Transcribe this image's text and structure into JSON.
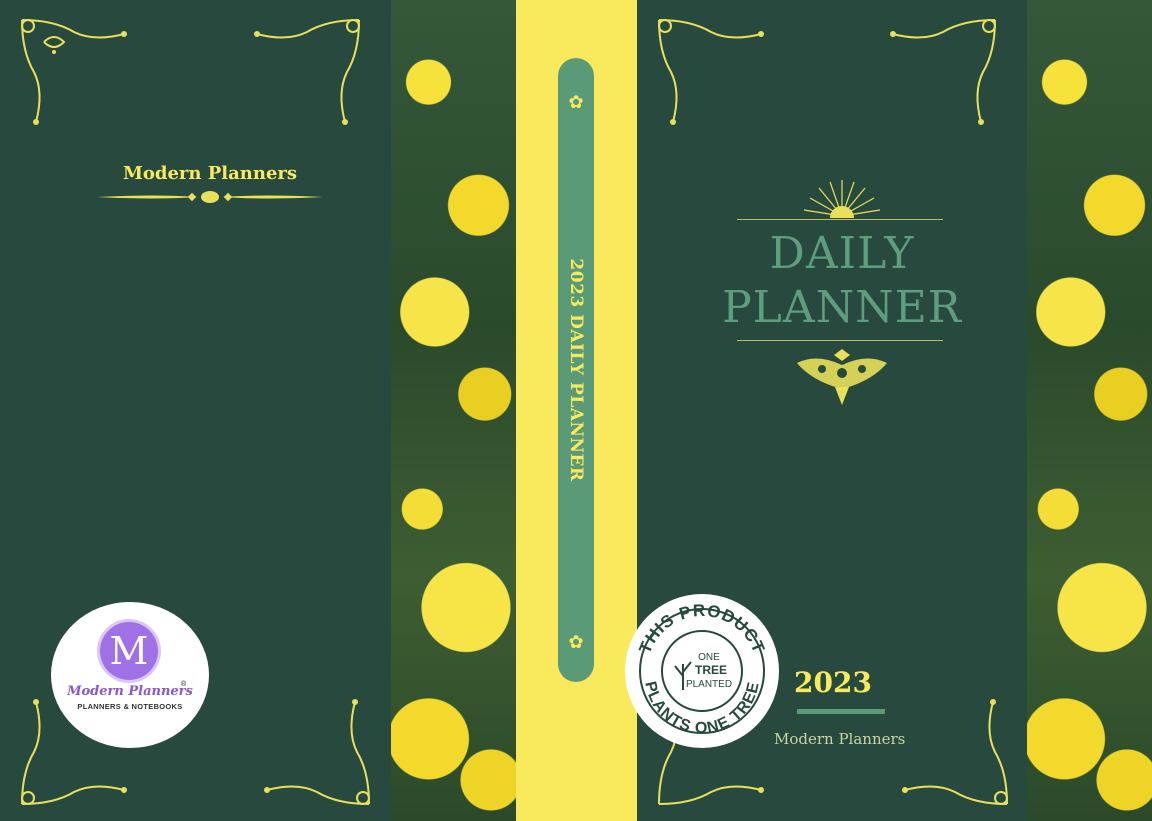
{
  "back_cover": {
    "brand_title": "Modern Planners",
    "logo": {
      "letter": "M",
      "script_name": "Modern Planners",
      "registered_mark": "®",
      "tagline": "PLANNERS & NOTEBOOKS"
    }
  },
  "spine": {
    "title": "2023 DAILY PLANNER"
  },
  "front_cover": {
    "title_line1": "DAILY",
    "title_line2": "PLANNER",
    "year": "2023",
    "brand": "Modern Planners",
    "badge": {
      "ring_top": "THIS PRODUCT",
      "ring_bottom": "PLANTS ONE TREE",
      "center_line1": "ONE",
      "center_line2": "TREE",
      "center_line3": "PLANTED"
    }
  },
  "colors": {
    "cover_green": "#284a3e",
    "accent_yellow": "#f9ea5d",
    "title_green": "#5e9e7e",
    "band_green": "#5a9a76"
  }
}
